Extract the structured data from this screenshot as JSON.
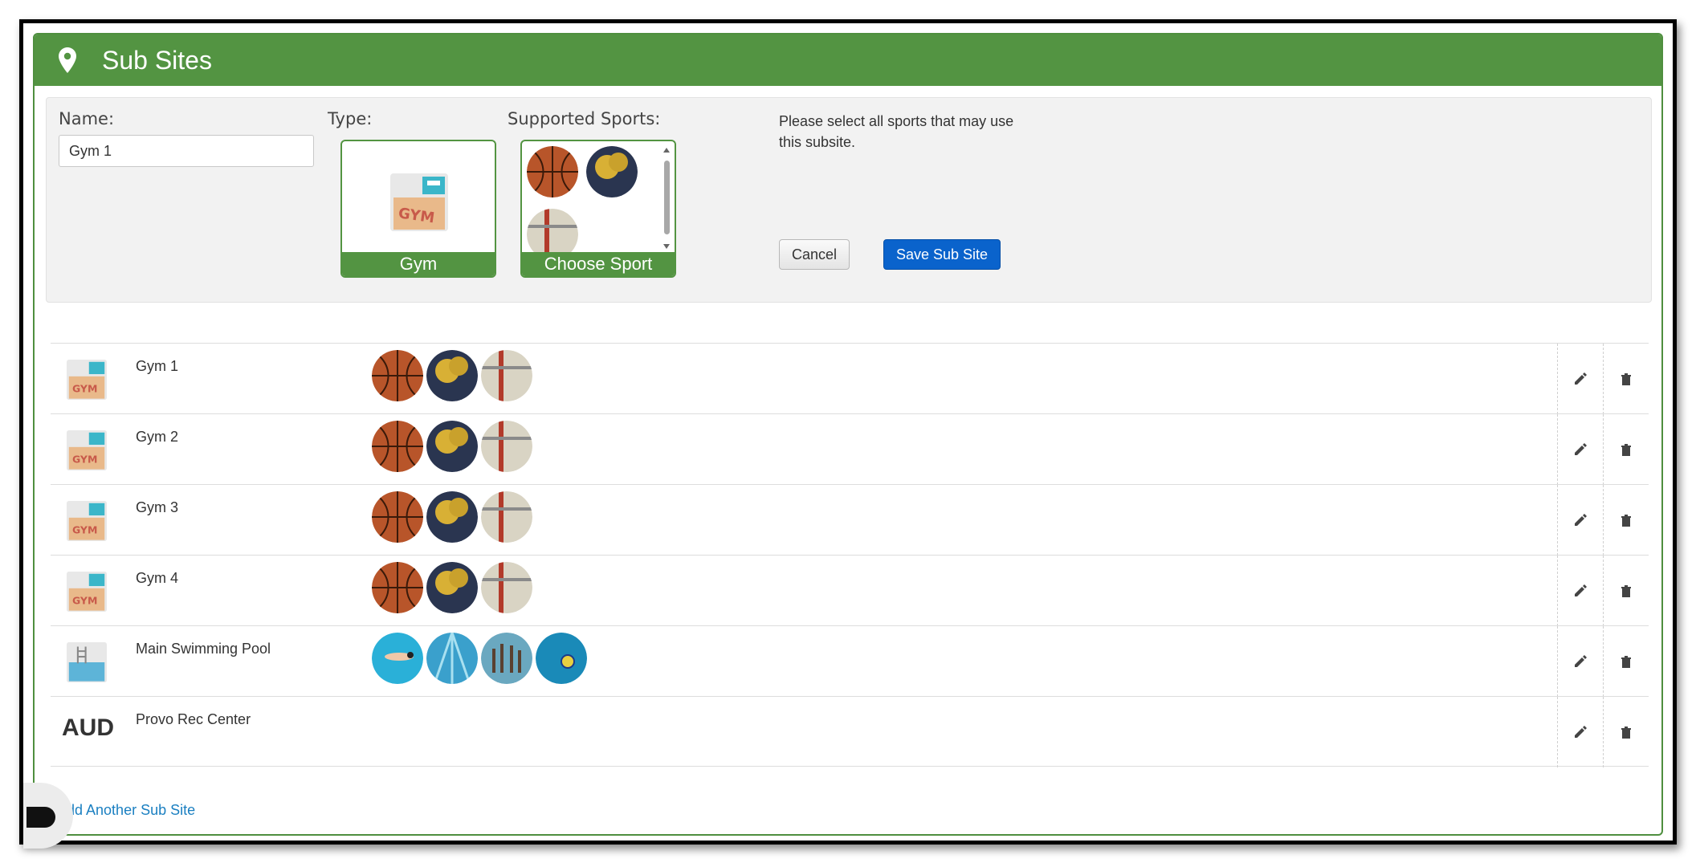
{
  "header": {
    "title": "Sub Sites",
    "icon": "map-pin-icon"
  },
  "form": {
    "name_label": "Name:",
    "name_value": "Gym 1",
    "type_label": "Type:",
    "type_selected": "Gym",
    "sports_label": "Supported Sports:",
    "choose_sport_label": "Choose Sport",
    "help_text": "Please select all sports that may use this subsite.",
    "cancel_label": "Cancel",
    "save_label": "Save Sub Site"
  },
  "subsites": [
    {
      "name": "Gym 1",
      "icon": "gym-icon",
      "sports": [
        "basketball",
        "pickleball",
        "volleyball"
      ]
    },
    {
      "name": "Gym 2",
      "icon": "gym-icon",
      "sports": [
        "basketball",
        "pickleball",
        "volleyball"
      ]
    },
    {
      "name": "Gym 3",
      "icon": "gym-icon",
      "sports": [
        "basketball",
        "pickleball",
        "volleyball"
      ]
    },
    {
      "name": "Gym 4",
      "icon": "gym-icon",
      "sports": [
        "basketball",
        "pickleball",
        "volleyball"
      ]
    },
    {
      "name": "Main Swimming Pool",
      "icon": "pool-icon",
      "sports": [
        "swimming",
        "lap-lanes",
        "synchronized-swimming",
        "water-polo"
      ]
    },
    {
      "name": "Provo Rec Center",
      "icon_text": "AUD",
      "sports": []
    }
  ],
  "add_link": "dd Another Sub Site",
  "colors": {
    "brand_green": "#539442",
    "primary_blue": "#0a63cc",
    "link_blue": "#1a7fc1"
  }
}
